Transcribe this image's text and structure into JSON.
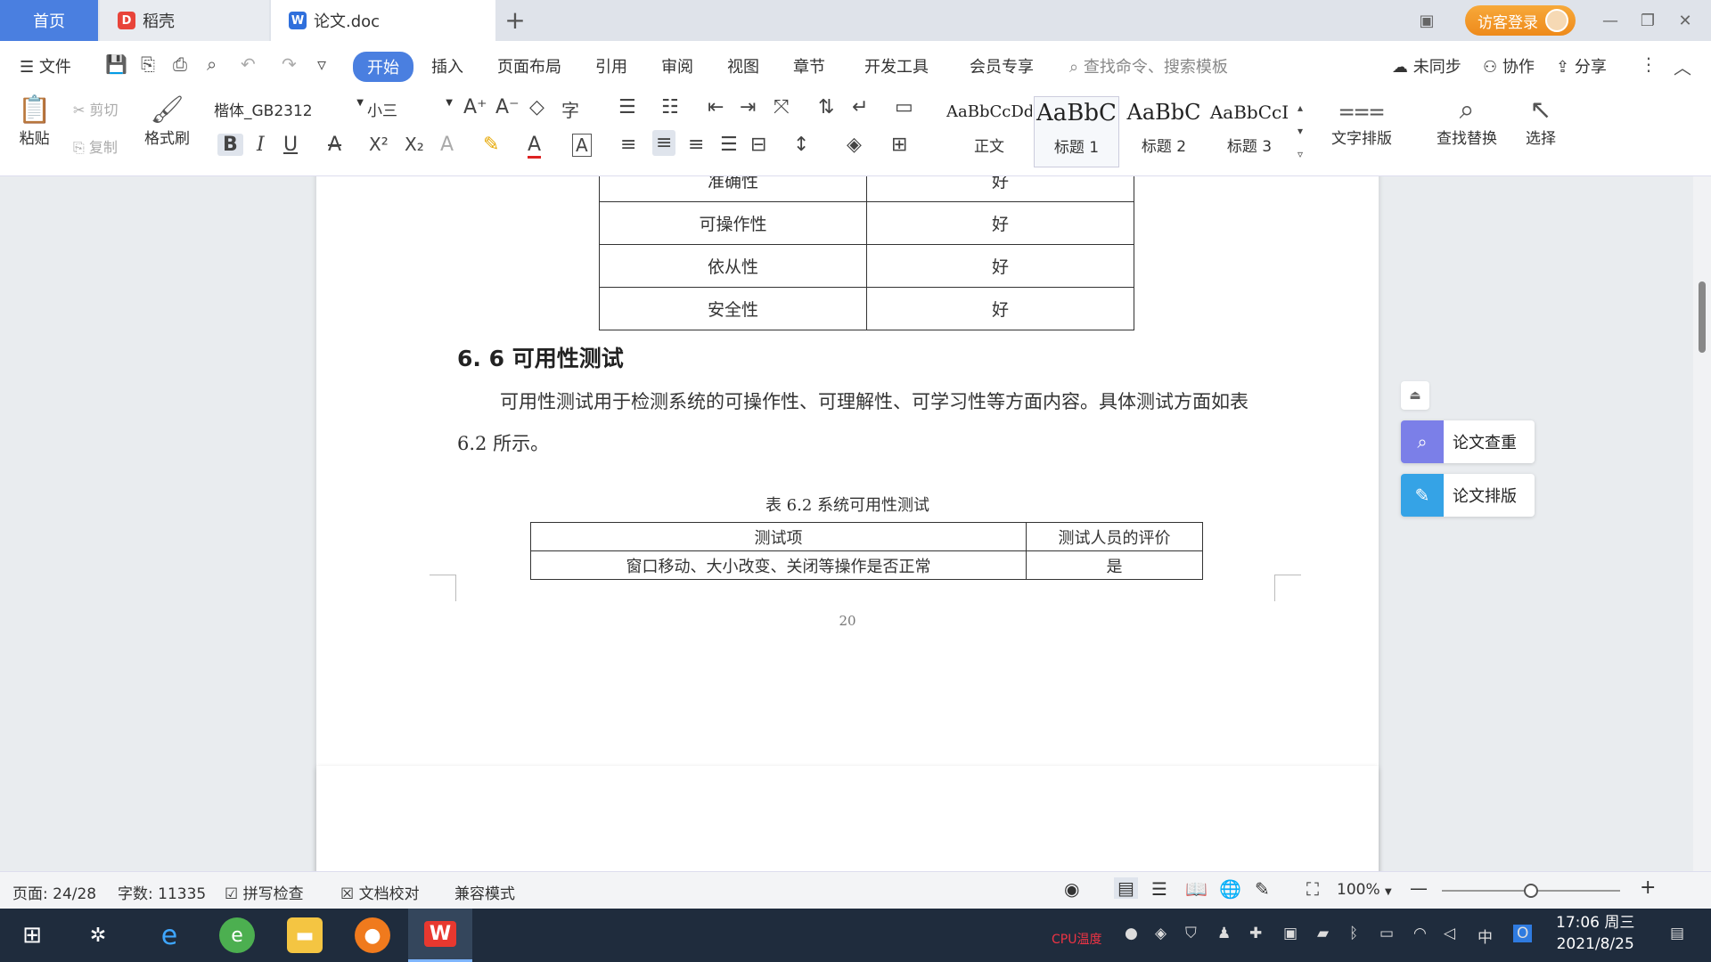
{
  "tabs": {
    "home": "首页",
    "daoke": "稻壳",
    "doc": "论文.doc"
  },
  "window": {
    "login": "访客登录"
  },
  "menu": {
    "file": "文件",
    "start": "开始",
    "insert": "插入",
    "layout": "页面布局",
    "reference": "引用",
    "review": "审阅",
    "view": "视图",
    "chapter": "章节",
    "devtools": "开发工具",
    "member": "会员专享",
    "search_cmd": "查找命令、搜索模板",
    "unsync": "未同步",
    "collab": "协作",
    "share": "分享"
  },
  "ribbon": {
    "paste": "粘贴",
    "cut": "剪切",
    "copy": "复制",
    "format_painter": "格式刷",
    "font_name": "楷体_GB2312",
    "font_size": "小三",
    "styles": [
      {
        "sample": "AaBbCcDd",
        "name": "正文"
      },
      {
        "sample": "AaBbC",
        "name": "标题 1"
      },
      {
        "sample": "AaBbC",
        "name": "标题 2"
      },
      {
        "sample": "AaBbCcI",
        "name": "标题 3"
      }
    ],
    "text_layout": "文字排版",
    "find_replace": "查找替换",
    "select": "选择"
  },
  "document": {
    "table1": [
      [
        "准确性",
        "好"
      ],
      [
        "可操作性",
        "好"
      ],
      [
        "依从性",
        "好"
      ],
      [
        "安全性",
        "好"
      ]
    ],
    "heading": "6. 6  可用性测试",
    "paragraph": "可用性测试用于检测系统的可操作性、可理解性、可学习性等方面内容。具体测试方面如表 6.2 所示。",
    "caption": "表 6.2   系统可用性测试",
    "table2_header": [
      "测试项",
      "测试人员的评价"
    ],
    "table2_rows": [
      [
        "窗口移动、大小改变、关闭等操作是否正常",
        "是"
      ]
    ],
    "page_number": "20"
  },
  "side_panel": {
    "check": "论文查重",
    "format": "论文排版"
  },
  "status": {
    "page": "页面: 24/28",
    "words": "字数: 11335",
    "spell": "拼写检查",
    "proof": "文档校对",
    "compat": "兼容模式",
    "zoom": "100%",
    "zoom_level": 0.5
  },
  "taskbar": {
    "time": "17:06 周三",
    "date": "2021/8/25",
    "ime": "中",
    "cpu_label": "CPU温度"
  },
  "colors": {
    "accent": "#4a7fe0",
    "login": "#f0921f",
    "taskbar": "#1f2c3d"
  }
}
